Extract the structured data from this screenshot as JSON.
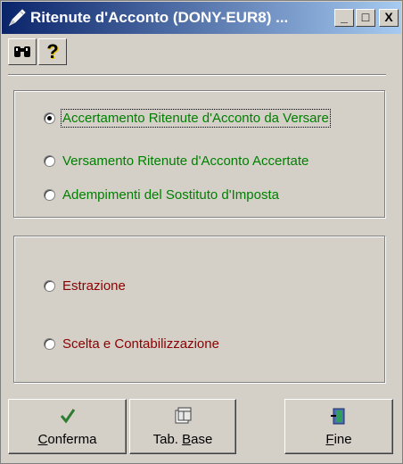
{
  "window": {
    "title": "Ritenute d'Acconto (DONY-EUR8) ...",
    "controls": {
      "minimize": "_",
      "maximize": "□",
      "close": "X"
    }
  },
  "toolbar": {
    "search_icon": "binoculars-icon",
    "help_icon": "question-icon",
    "help_glyph": "?"
  },
  "group1": {
    "options": [
      {
        "label": "Accertamento Ritenute d'Acconto da Versare",
        "checked": true
      },
      {
        "label": "Versamento Ritenute d'Acconto Accertate",
        "checked": false
      },
      {
        "label": "Adempimenti del Sostituto d'Imposta",
        "checked": false
      }
    ]
  },
  "group2": {
    "options": [
      {
        "label": "Estrazione",
        "checked": false
      },
      {
        "label": "Scelta e Contabilizzazione",
        "checked": false
      }
    ]
  },
  "buttons": {
    "confirm": {
      "mnemonic": "C",
      "rest": "onferma"
    },
    "tab_base": {
      "prefix": "Tab. ",
      "mnemonic": "B",
      "rest": "ase"
    },
    "end": {
      "mnemonic": "F",
      "rest": "ine"
    }
  },
  "colors": {
    "green_text": "#008000",
    "red_text": "#8b0000",
    "title_start": "#0a246a",
    "title_end": "#a6caf0"
  }
}
